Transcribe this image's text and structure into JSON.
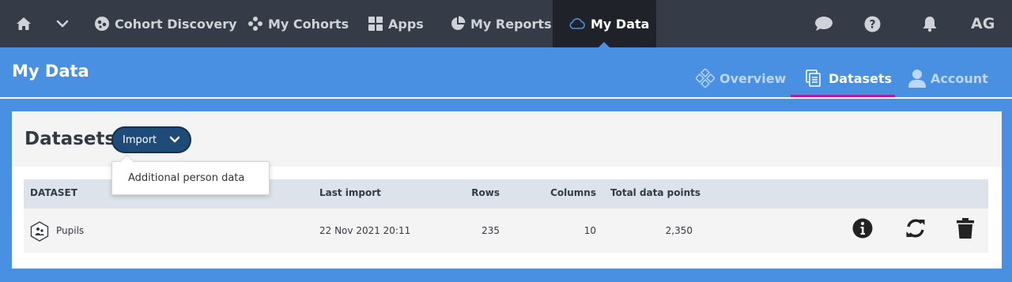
{
  "topnav": {
    "items": [
      {
        "label": "",
        "icon": "home-icon"
      },
      {
        "label": "",
        "icon": "chevron-down-icon"
      },
      {
        "label": "Cohort Discovery",
        "icon": "cohort-discovery-icon"
      },
      {
        "label": "My Cohorts",
        "icon": "cohorts-icon"
      },
      {
        "label": "Apps",
        "icon": "apps-grid-icon"
      },
      {
        "label": "My Reports",
        "icon": "pie-chart-icon"
      },
      {
        "label": "My Data",
        "icon": "cloud-icon",
        "active": true
      }
    ],
    "right": {
      "chat_icon": "chat-bubble-icon",
      "help_icon": "help-icon",
      "bell_icon": "bell-icon",
      "user_initials": "AG"
    }
  },
  "header": {
    "title": "My Data",
    "tabs": [
      {
        "label": "Overview",
        "icon": "overview-icon"
      },
      {
        "label": "Datasets",
        "icon": "datasets-icon",
        "active": true
      },
      {
        "label": "Account",
        "icon": "user-icon"
      }
    ]
  },
  "datasets": {
    "title": "Datasets",
    "import_button": "Import",
    "import_menu": [
      "Additional person data"
    ],
    "columns": {
      "dataset": "DATASET",
      "last_import": "Last import",
      "rows": "Rows",
      "columns": "Columns",
      "total": "Total data points"
    },
    "rows": [
      {
        "name": "Pupils",
        "last_import": "22 Nov 2021 20:11",
        "rows": "235",
        "columns": "10",
        "total": "2,350"
      }
    ],
    "row_actions": [
      "info-icon",
      "refresh-icon",
      "trash-icon"
    ]
  },
  "colors": {
    "nav_bg": "#363c47",
    "nav_active_bg": "#1f2329",
    "band_blue": "#4a90e2",
    "tab_underline": "#b51c9d",
    "button_bg": "#1f4b79"
  }
}
